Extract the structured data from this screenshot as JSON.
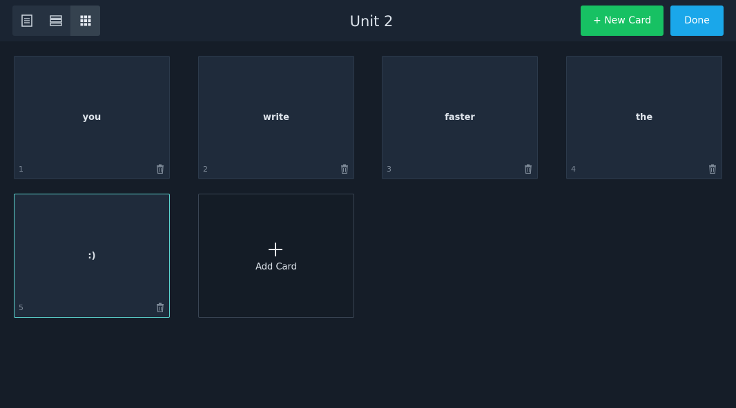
{
  "header": {
    "title": "Unit 2",
    "new_card_label": "+ New Card",
    "done_label": "Done",
    "view_modes": [
      {
        "icon": "document-view-icon",
        "active": false
      },
      {
        "icon": "list-view-icon",
        "active": false
      },
      {
        "icon": "grid-view-icon",
        "active": true
      }
    ]
  },
  "cards": [
    {
      "number": "1",
      "text": "you",
      "selected": false
    },
    {
      "number": "2",
      "text": "write",
      "selected": false
    },
    {
      "number": "3",
      "text": "faster",
      "selected": false
    },
    {
      "number": "4",
      "text": "the",
      "selected": false
    },
    {
      "number": "5",
      "text": ":)",
      "selected": true
    }
  ],
  "add_card": {
    "label": "Add Card",
    "icon": "plus-icon"
  },
  "colors": {
    "background": "#151d28",
    "header": "#1a2432",
    "card": "#1f2b3b",
    "selected_border": "#5cd4cf",
    "new_card_button": "#17c163",
    "done_button": "#1aa7ea"
  }
}
